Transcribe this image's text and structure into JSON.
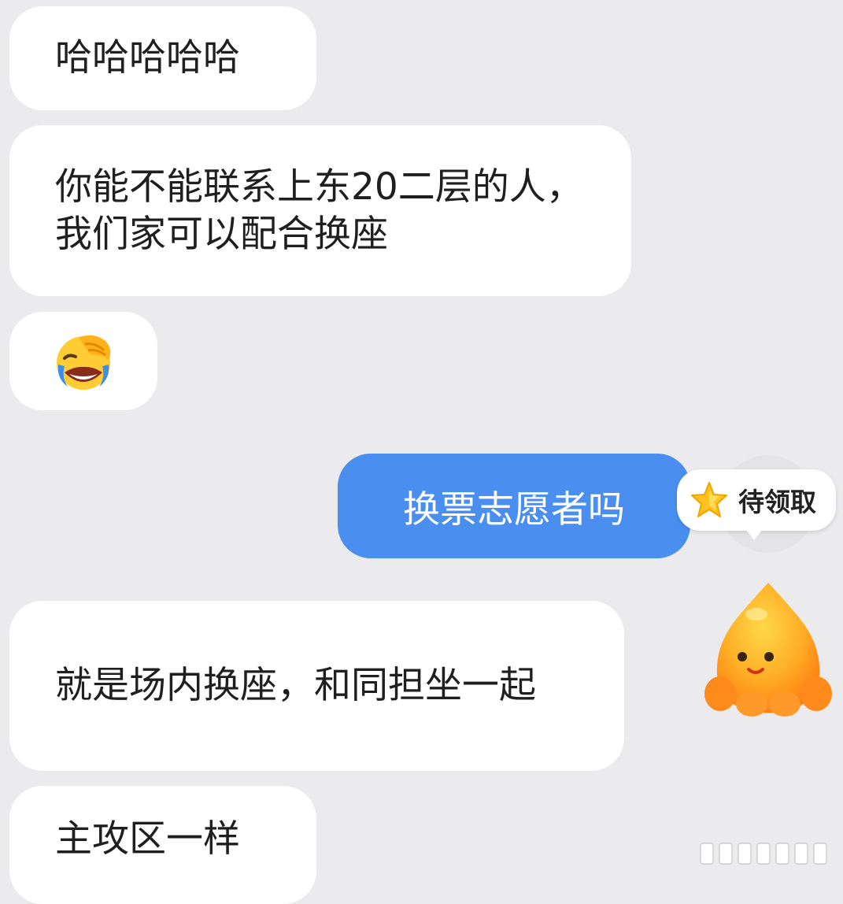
{
  "messages": [
    {
      "side": "left",
      "text": "哈哈哈哈哈"
    },
    {
      "side": "left",
      "text": "你能不能联系上东20二层的人，我们家可以配合换座"
    },
    {
      "side": "left",
      "type": "emoji",
      "icon": "facepalm-laughing-emoji-icon"
    },
    {
      "side": "right",
      "text": "换票志愿者吗"
    },
    {
      "side": "left",
      "text": "就是场内换座，和同担坐一起"
    },
    {
      "side": "left",
      "text": "主攻区一样"
    }
  ],
  "reward_badge": {
    "label": "待领取",
    "icon": "star-icon"
  },
  "colors": {
    "background": "#ebebed",
    "incoming_bubble": "#ffffff",
    "outgoing_bubble": "#4a8ff0",
    "text": "#1f1f1f"
  }
}
